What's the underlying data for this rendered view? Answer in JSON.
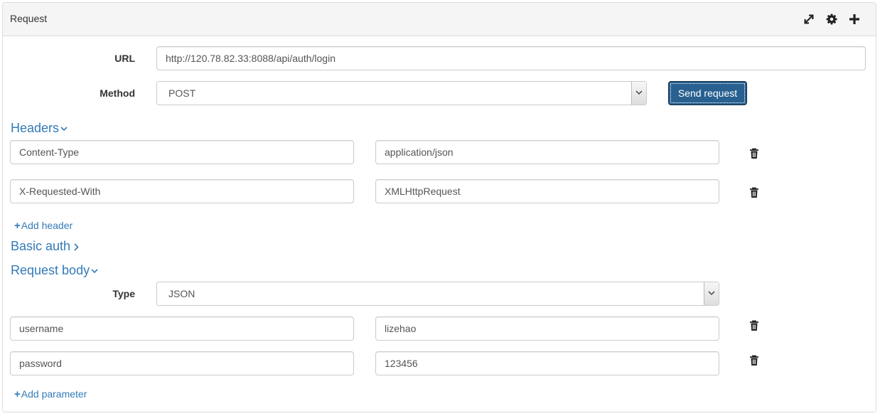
{
  "panel": {
    "title": "Request",
    "icons": [
      "expand-icon",
      "gear-icon",
      "plus-icon"
    ]
  },
  "url": {
    "label": "URL",
    "value": "http://120.78.82.33:8088/api/auth/login"
  },
  "method": {
    "label": "Method",
    "value": "POST"
  },
  "send_button": "Send request",
  "headers": {
    "title": "Headers",
    "rows": [
      {
        "name": "Content-Type",
        "value": "application/json"
      },
      {
        "name": "X-Requested-With",
        "value": "XMLHttpRequest"
      }
    ],
    "add_label": "Add header"
  },
  "basic_auth": {
    "title": "Basic auth"
  },
  "request_body": {
    "title": "Request body",
    "type_label": "Type",
    "type_value": "JSON",
    "params": [
      {
        "name": "username",
        "value": "lizehao"
      },
      {
        "name": "password",
        "value": "123456"
      }
    ],
    "add_label": "Add parameter"
  },
  "colors": {
    "link": "#337ab7",
    "button": "#286090",
    "heading_bg": "#f5f5f5",
    "border": "#cccccc"
  }
}
